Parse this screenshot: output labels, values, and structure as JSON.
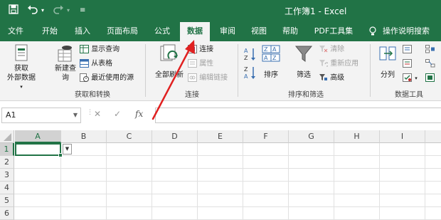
{
  "titlebar": {
    "save_icon": "save-icon",
    "undo_icon": "undo-icon",
    "redo_icon": "redo-icon",
    "title": "工作簿1 - Excel"
  },
  "tabs": [
    {
      "label": "文件"
    },
    {
      "label": "开始"
    },
    {
      "label": "插入"
    },
    {
      "label": "页面布局"
    },
    {
      "label": "公式"
    },
    {
      "label": "数据"
    },
    {
      "label": "审阅"
    },
    {
      "label": "视图"
    },
    {
      "label": "帮助"
    },
    {
      "label": "PDF工具集"
    },
    {
      "label": "操作说明搜索"
    }
  ],
  "ribbon": {
    "get_transform": {
      "get_data_line1": "获取",
      "get_data_line2": "外部数据",
      "new_query_line1": "新建查",
      "new_query_line2": "询",
      "show_queries": "显示查询",
      "from_table": "从表格",
      "recent_sources": "最近使用的源",
      "group_label": "获取和转换"
    },
    "connections": {
      "refresh_all": "全部刷新",
      "connections": "连接",
      "properties": "属性",
      "edit_links": "编辑链接",
      "group_label": "连接"
    },
    "sort_filter": {
      "sort": "排序",
      "filter": "筛选",
      "clear": "清除",
      "reapply": "重新应用",
      "advanced": "高级",
      "group_label": "排序和筛选"
    },
    "data_tools": {
      "text_to_columns": "分列",
      "group_label": "数据工具"
    }
  },
  "formula_bar": {
    "name_box": "A1",
    "cancel_glyph": "✕",
    "enter_glyph": "✓",
    "fx_label": "fx",
    "formula_value": ""
  },
  "grid": {
    "columns": [
      "A",
      "B",
      "C",
      "D",
      "E",
      "F",
      "G",
      "H",
      "I"
    ],
    "rows": [
      "1",
      "2",
      "3",
      "4",
      "5",
      "6"
    ],
    "selected_cell": "A1"
  },
  "colors": {
    "accent": "#217346",
    "annotation_arrow": "#e02020"
  }
}
